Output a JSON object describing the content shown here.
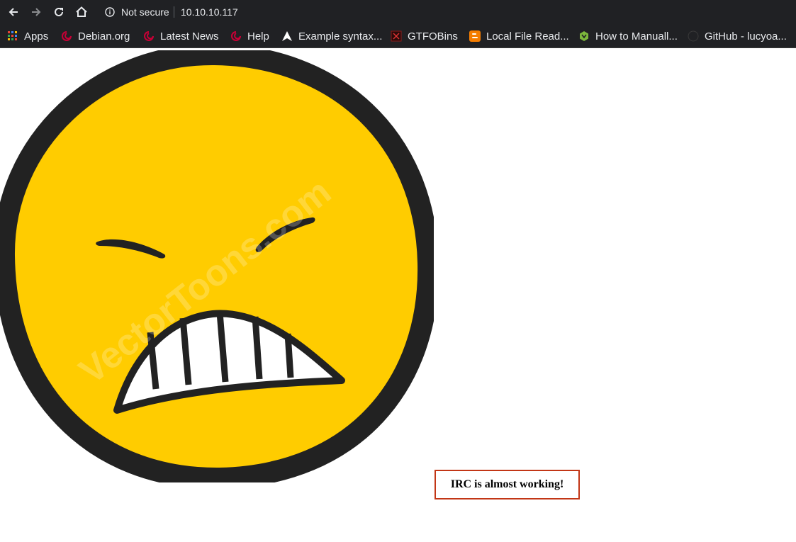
{
  "browser": {
    "security_label": "Not secure",
    "url": "10.10.10.117",
    "icons": [
      "back-icon",
      "forward-icon",
      "reload-icon",
      "home-icon",
      "info-icon"
    ]
  },
  "bookmarks": [
    {
      "label": "Apps",
      "icon": "apps-grid-icon"
    },
    {
      "label": "Debian.org",
      "icon": "debian-icon"
    },
    {
      "label": "Latest News",
      "icon": "debian-icon"
    },
    {
      "label": "Help",
      "icon": "debian-icon"
    },
    {
      "label": "Example syntax...",
      "icon": "arch-icon"
    },
    {
      "label": "GTFOBins",
      "icon": "gtfobins-icon"
    },
    {
      "label": "Local File Read...",
      "icon": "blogger-icon"
    },
    {
      "label": "How to Manuall...",
      "icon": "green-site-icon"
    },
    {
      "label": "GitHub - lucyoa...",
      "icon": "github-icon"
    }
  ],
  "page": {
    "image_watermark": "VectorToons.com",
    "message": "IRC is almost working!"
  },
  "colors": {
    "chrome_bg": "#202124",
    "face_yellow": "#ffcc00",
    "face_outline": "#222222",
    "box_border": "#c23616"
  }
}
